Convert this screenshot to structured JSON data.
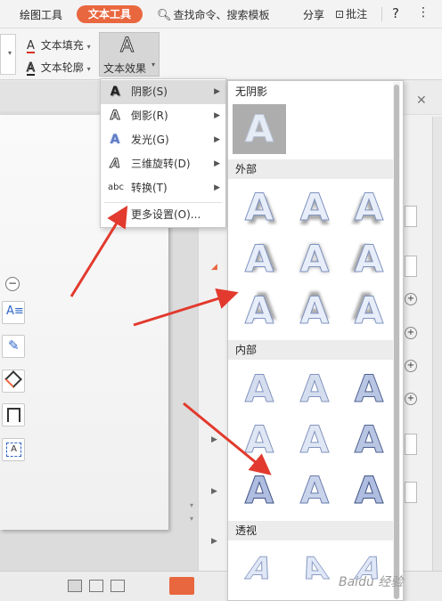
{
  "menubar": {
    "tab_drawing": "绘图工具",
    "tab_text": "文本工具",
    "search": "查找命令、搜索模板",
    "share": "分享",
    "annotate": "批注",
    "help": "?",
    "more": "⋮"
  },
  "ribbon": {
    "text_fill": "文本填充",
    "text_outline": "文本轮廓",
    "text_effect": "文本效果"
  },
  "effects_menu": {
    "items": [
      {
        "label": "阴影(S)",
        "icon": "shadow-a-icon"
      },
      {
        "label": "倒影(R)",
        "icon": "reflection-a-icon"
      },
      {
        "label": "发光(G)",
        "icon": "glow-a-icon"
      },
      {
        "label": "三维旋转(D)",
        "icon": "3d-rotation-a-icon"
      },
      {
        "label": "转换(T)",
        "icon": "transform-abc-icon"
      }
    ],
    "more": "更多设置(O)..."
  },
  "gallery": {
    "no_shadow": "无阴影",
    "outer": "外部",
    "inner": "内部",
    "perspective": "透视",
    "glyph": "A"
  },
  "watermark": "Baidu 经验",
  "colors": {
    "accent": "#e9673f",
    "arrow": "#e23a2e"
  }
}
